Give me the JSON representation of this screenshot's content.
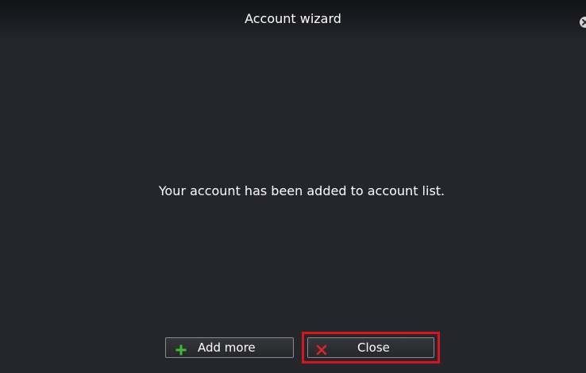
{
  "window": {
    "title": "Account wizard",
    "close_icon": "close-circle-icon"
  },
  "main": {
    "message": "Your account has been added to account list."
  },
  "buttons": {
    "add_more": {
      "label": "Add more",
      "icon": "plus-icon",
      "icon_color": "#3fb936"
    },
    "close": {
      "label": "Close",
      "icon": "x-icon",
      "icon_color": "#d8262b"
    }
  },
  "annotation": {
    "highlight_color": "#d8151d",
    "highlighted": "close-button"
  },
  "colors": {
    "background": "#25262c",
    "titlebar": "#121316",
    "text": "#ffffff"
  }
}
